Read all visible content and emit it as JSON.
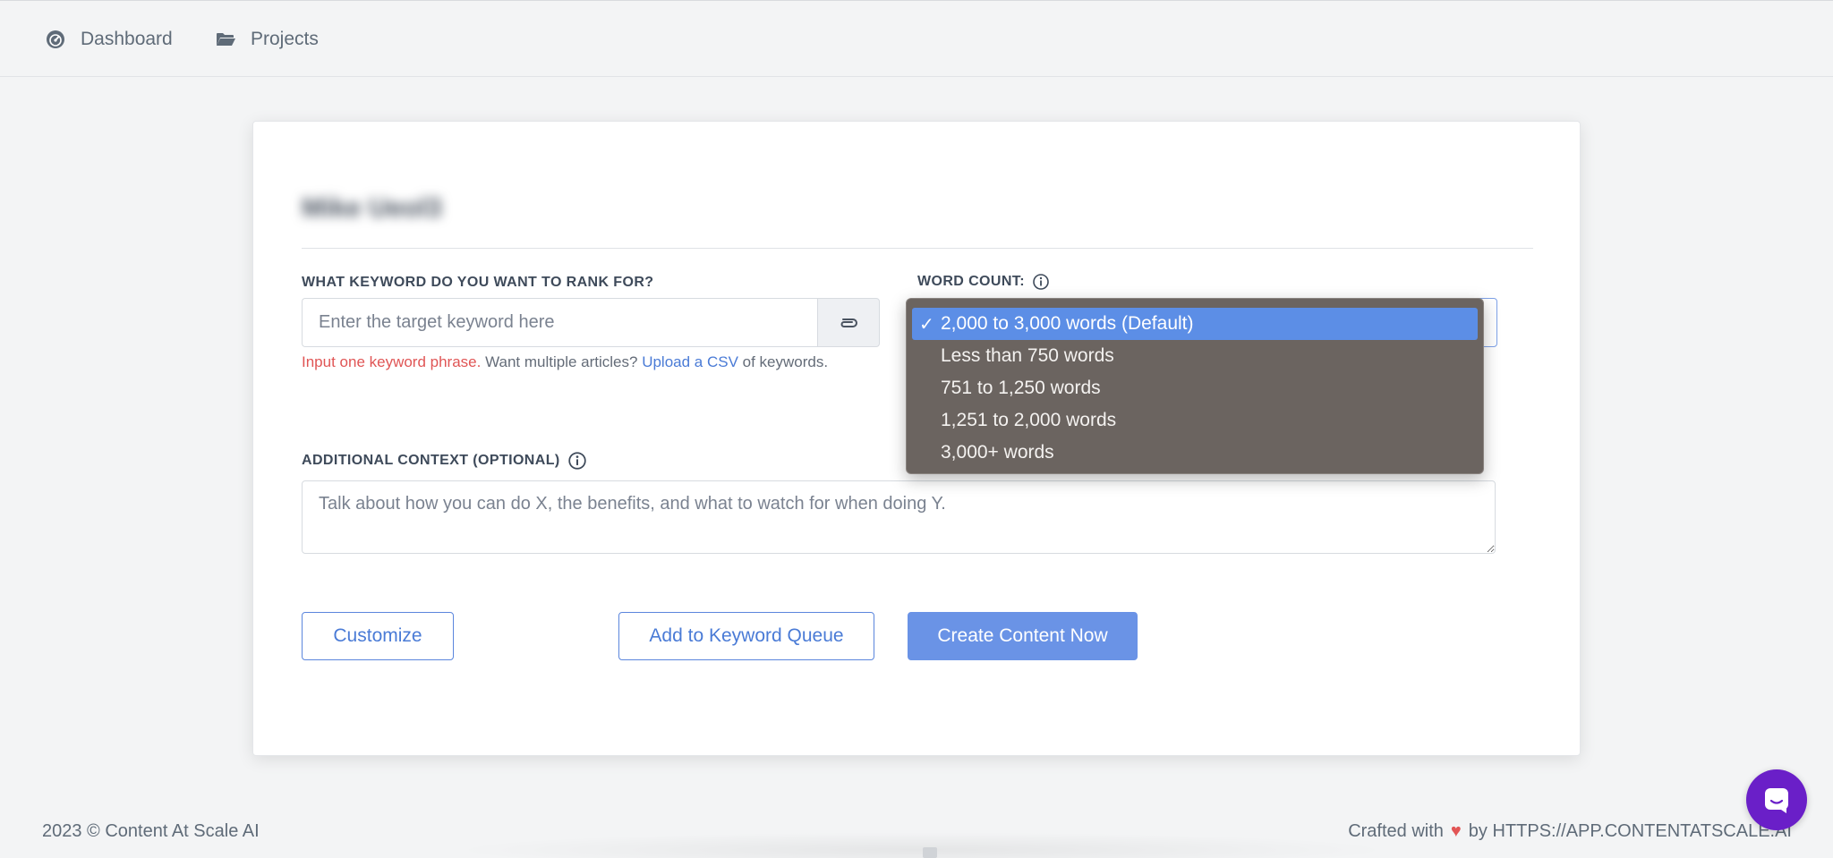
{
  "nav": {
    "dashboard_label": "Dashboard",
    "projects_label": "Projects"
  },
  "card": {
    "title": "Mike Ueol3"
  },
  "keyword": {
    "label": "WHAT KEYWORD DO YOU WANT TO RANK FOR?",
    "placeholder": "Enter the target keyword here",
    "help_error": "Input one keyword phrase.",
    "help_middle": " Want multiple articles? ",
    "help_link": "Upload a CSV",
    "help_tail": " of keywords."
  },
  "word_count": {
    "label": "WORD COUNT:",
    "selected": "2,000 to 3,000 words (Default)",
    "options": [
      "2,000 to 3,000 words (Default)",
      "Less than 750 words",
      "751 to 1,250 words",
      "1,251 to 2,000 words",
      "3,000+ words"
    ],
    "check_mark": "✓"
  },
  "context": {
    "label": "ADDITIONAL CONTEXT (OPTIONAL)",
    "placeholder": "Talk about how you can do X, the benefits, and what to watch for when doing Y."
  },
  "buttons": {
    "customize": "Customize",
    "add_queue": "Add to Keyword Queue",
    "create_now": "Create Content Now"
  },
  "footer": {
    "copyright": "2023 © Content At Scale AI",
    "crafted_prefix": "Crafted with",
    "crafted_suffix": "by HTTPS://APP.CONTENTATSCALE.AI"
  },
  "colors": {
    "accent": "#6a93e6",
    "link": "#4a7bd6",
    "error": "#e05555",
    "chat": "#6a1fc8",
    "dropdown_bg": "#6b6460",
    "dropdown_selected": "#5c8ee6"
  }
}
